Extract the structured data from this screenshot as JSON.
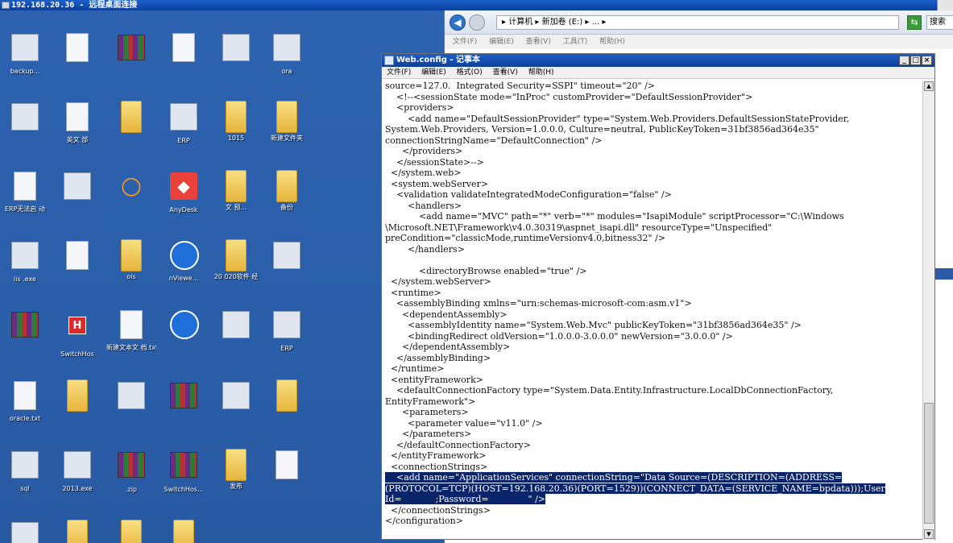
{
  "rdp": {
    "title": "192.168.20.36 - 远程桌面连接"
  },
  "desktop": {
    "icons": [
      {
        "label": "backup...",
        "type": "exe"
      },
      {
        "label": "",
        "type": "doc"
      },
      {
        "label": "",
        "type": "rar"
      },
      {
        "label": "",
        "type": "doc"
      },
      {
        "label": "",
        "type": "exe"
      },
      {
        "label": "ora",
        "type": "exe"
      },
      {
        "label": "",
        "type": "exe"
      },
      {
        "label": "英文 部",
        "type": "doc"
      },
      {
        "label": "",
        "type": "folder"
      },
      {
        "label": "ERP",
        "type": "exe"
      },
      {
        "label": "1015",
        "type": "folder"
      },
      {
        "label": "新建文件夹",
        "type": "folder"
      },
      {
        "label": "ERP无法启 动",
        "type": "doc"
      },
      {
        "label": "",
        "type": "exe"
      },
      {
        "label": "",
        "type": "mag"
      },
      {
        "label": "AnyDesk",
        "type": "any"
      },
      {
        "label": "文 预...",
        "type": "folder"
      },
      {
        "label": "备份",
        "type": "folder"
      },
      {
        "label": "iis .exe",
        "type": "exe"
      },
      {
        "label": "",
        "type": "doc"
      },
      {
        "label": "ols",
        "type": "folder"
      },
      {
        "label": "nViewe...",
        "type": "tv"
      },
      {
        "label": "20 020软件 经",
        "type": "folder"
      },
      {
        "label": "",
        "type": "exe"
      },
      {
        "label": "",
        "type": "rar"
      },
      {
        "label": "SwitchHos",
        "type": "swh"
      },
      {
        "label": "新建文本文 档.txt",
        "type": "doc"
      },
      {
        "label": "",
        "type": "tv"
      },
      {
        "label": "",
        "type": "exe"
      },
      {
        "label": "ERP",
        "type": "exe"
      },
      {
        "label": "oracle.txt",
        "type": "doc"
      },
      {
        "label": "",
        "type": "folder"
      },
      {
        "label": "",
        "type": "exe"
      },
      {
        "label": "",
        "type": "rar"
      },
      {
        "label": "",
        "type": "exe"
      },
      {
        "label": "",
        "type": "folder"
      },
      {
        "label": "sql",
        "type": "exe"
      },
      {
        "label": "2013.exe",
        "type": "exe"
      },
      {
        "label": ".zip",
        "type": "rar"
      },
      {
        "label": "SwitchHos...",
        "type": "rar"
      },
      {
        "label": "发布",
        "type": "folder"
      },
      {
        "label": "",
        "type": "doc"
      },
      {
        "label": "",
        "type": "exe"
      },
      {
        "label": "",
        "type": "folder"
      },
      {
        "label": "",
        "type": "folder"
      },
      {
        "label": "",
        "type": "folder"
      }
    ]
  },
  "explorer": {
    "path": "▸ 计算机 ▸ 新加卷 (E:) ▸ ... ▸",
    "search_label": "搜索",
    "menu": [
      "文件(F)",
      "编辑(E)",
      "查看(V)",
      "工具(T)",
      "帮助(H)"
    ]
  },
  "notepad": {
    "title": "Web.config - 记事本",
    "menu": [
      "文件(F)",
      "编辑(E)",
      "格式(O)",
      "查看(V)",
      "帮助(H)"
    ],
    "lines": [
      {
        "t": "source=127.0.  Integrated Security=SSPI\" timeout=\"20\" />",
        "sel": false
      },
      {
        "t": "    <!--<sessionState mode=\"InProc\" customProvider=\"DefaultSessionProvider\">",
        "sel": false
      },
      {
        "t": "    <providers>",
        "sel": false
      },
      {
        "t": "        <add name=\"DefaultSessionProvider\" type=\"System.Web.Providers.DefaultSessionStateProvider,",
        "sel": false
      },
      {
        "t": "System.Web.Providers, Version=1.0.0.0, Culture=neutral, PublicKeyToken=31bf3856ad364e35\"",
        "sel": false
      },
      {
        "t": "connectionStringName=\"DefaultConnection\" />",
        "sel": false
      },
      {
        "t": "      </providers>",
        "sel": false
      },
      {
        "t": "    </sessionState>-->",
        "sel": false
      },
      {
        "t": "  </system.web>",
        "sel": false
      },
      {
        "t": "  <system.webServer>",
        "sel": false
      },
      {
        "t": "    <validation validateIntegratedModeConfiguration=\"false\" />",
        "sel": false
      },
      {
        "t": "        <handlers>",
        "sel": false
      },
      {
        "t": "            <add name=\"MVC\" path=\"*\" verb=\"*\" modules=\"IsapiModule\" scriptProcessor=\"C:\\Windows",
        "sel": false
      },
      {
        "t": "\\Microsoft.NET\\Framework\\v4.0.30319\\aspnet_isapi.dll\" resourceType=\"Unspecified\"",
        "sel": false
      },
      {
        "t": "preCondition=\"classicMode,runtimeVersionv4.0,bitness32\" />",
        "sel": false
      },
      {
        "t": "        </handlers>",
        "sel": false
      },
      {
        "t": "",
        "sel": false
      },
      {
        "t": "            <directoryBrowse enabled=\"true\" />",
        "sel": false
      },
      {
        "t": "  </system.webServer>",
        "sel": false
      },
      {
        "t": "  <runtime>",
        "sel": false
      },
      {
        "t": "    <assemblyBinding xmlns=\"urn:schemas-microsoft-com:asm.v1\">",
        "sel": false
      },
      {
        "t": "      <dependentAssembly>",
        "sel": false
      },
      {
        "t": "        <assemblyIdentity name=\"System.Web.Mvc\" publicKeyToken=\"31bf3856ad364e35\" />",
        "sel": false
      },
      {
        "t": "        <bindingRedirect oldVersion=\"1.0.0.0-3.0.0.0\" newVersion=\"3.0.0.0\" />",
        "sel": false
      },
      {
        "t": "      </dependentAssembly>",
        "sel": false
      },
      {
        "t": "    </assemblyBinding>",
        "sel": false
      },
      {
        "t": "  </runtime>",
        "sel": false
      },
      {
        "t": "  <entityFramework>",
        "sel": false
      },
      {
        "t": "    <defaultConnectionFactory type=\"System.Data.Entity.Infrastructure.LocalDbConnectionFactory,",
        "sel": false
      },
      {
        "t": "EntityFramework\">",
        "sel": false
      },
      {
        "t": "      <parameters>",
        "sel": false
      },
      {
        "t": "        <parameter value=\"v11.0\" />",
        "sel": false
      },
      {
        "t": "      </parameters>",
        "sel": false
      },
      {
        "t": "    </defaultConnectionFactory>",
        "sel": false
      },
      {
        "t": "  </entityFramework>",
        "sel": false
      },
      {
        "t": "  <connectionStrings>",
        "sel": false
      },
      {
        "t": "    <add name=\"ApplicationServices\" connectionString=\"Data Source=(DESCRIPTION=(ADDRESS=",
        "sel": true
      },
      {
        "t": "(PROTOCOL=TCP)(HOST=192.168.20.36)(PORT=1529))(CONNECT_DATA=(SERVICE_NAME=bpdata)));User",
        "sel": true
      },
      {
        "t": "Id=            ;Password=              \" />",
        "sel": true
      },
      {
        "t": "  </connectionStrings>",
        "sel": false
      },
      {
        "t": "</configuration>",
        "sel": false
      }
    ]
  }
}
